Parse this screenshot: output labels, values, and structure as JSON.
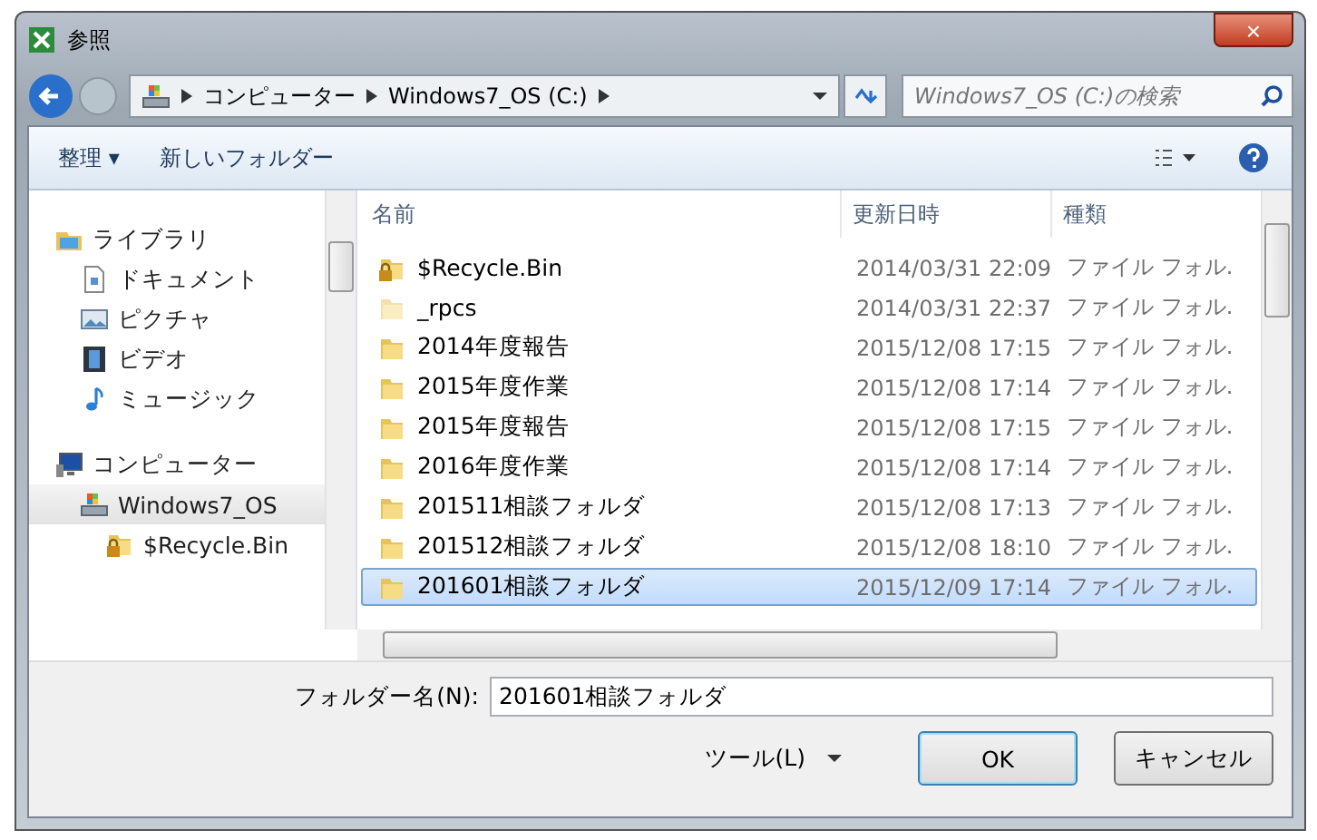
{
  "window": {
    "title": "参照",
    "close": "×"
  },
  "address": {
    "crumbs": [
      "コンピューター",
      "Windows7_OS (C:)"
    ],
    "search_placeholder": "Windows7_OS (C:)の検索"
  },
  "toolbar": {
    "organize": "整理 ▾",
    "new_folder": "新しいフォルダー"
  },
  "sidebar": {
    "items": [
      {
        "label": "ライブラリ",
        "kind": "library",
        "selected": false,
        "children": [
          {
            "label": "ドキュメント",
            "kind": "document",
            "selected": false
          },
          {
            "label": "ピクチャ",
            "kind": "picture",
            "selected": false
          },
          {
            "label": "ビデオ",
            "kind": "video",
            "selected": false
          },
          {
            "label": "ミュージック",
            "kind": "music",
            "selected": false
          }
        ]
      },
      {
        "label": "コンピューター",
        "kind": "computer",
        "selected": false,
        "children": [
          {
            "label": "Windows7_OS",
            "kind": "drive",
            "selected": true,
            "children": [
              {
                "label": "$Recycle.Bin",
                "kind": "locked",
                "selected": false
              }
            ]
          }
        ]
      }
    ]
  },
  "table": {
    "columns": [
      "名前",
      "更新日時",
      "種類"
    ],
    "rows": [
      {
        "name": "$Recycle.Bin",
        "kind": "locked",
        "hidden": false,
        "date": "2014/03/31 22:09",
        "type": "ファイル フォル.",
        "selected": false
      },
      {
        "name": "_rpcs",
        "kind": "folder",
        "hidden": true,
        "date": "2014/03/31 22:37",
        "type": "ファイル フォル.",
        "selected": false
      },
      {
        "name": "2014年度報告",
        "kind": "folder",
        "hidden": false,
        "date": "2015/12/08 17:15",
        "type": "ファイル フォル.",
        "selected": false
      },
      {
        "name": "2015年度作業",
        "kind": "folder",
        "hidden": false,
        "date": "2015/12/08 17:14",
        "type": "ファイル フォル.",
        "selected": false
      },
      {
        "name": "2015年度報告",
        "kind": "folder",
        "hidden": false,
        "date": "2015/12/08 17:15",
        "type": "ファイル フォル.",
        "selected": false
      },
      {
        "name": "2016年度作業",
        "kind": "folder",
        "hidden": false,
        "date": "2015/12/08 17:14",
        "type": "ファイル フォル.",
        "selected": false
      },
      {
        "name": "201511相談フォルダ",
        "kind": "folder",
        "hidden": false,
        "date": "2015/12/08 17:13",
        "type": "ファイル フォル.",
        "selected": false
      },
      {
        "name": "201512相談フォルダ",
        "kind": "folder",
        "hidden": false,
        "date": "2015/12/08 18:10",
        "type": "ファイル フォル.",
        "selected": false
      },
      {
        "name": "201601相談フォルダ",
        "kind": "folder",
        "hidden": false,
        "date": "2015/12/09 17:14",
        "type": "ファイル フォル.",
        "selected": true
      }
    ]
  },
  "folder_name": {
    "label": "フォルダー名(N):",
    "value": "201601相談フォルダ"
  },
  "buttons": {
    "tools": "ツール(L)",
    "ok": "OK",
    "cancel": "キャンセル"
  }
}
